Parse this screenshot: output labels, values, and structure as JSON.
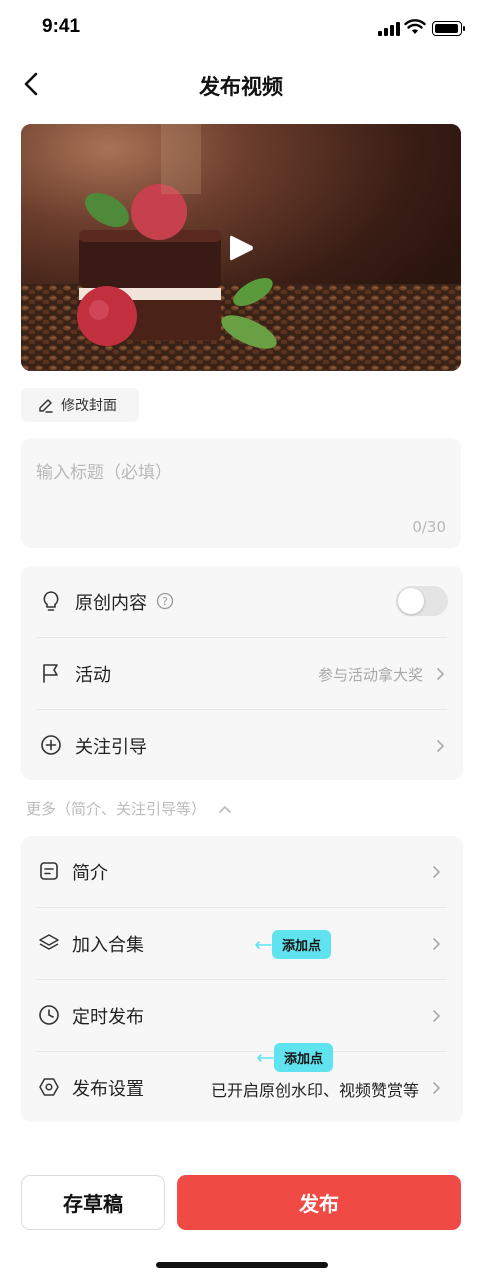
{
  "status_bar": {
    "time": "9:41"
  },
  "nav": {
    "title": "发布视频"
  },
  "video": {
    "cover_button_label": "修改封面"
  },
  "title_input": {
    "placeholder": "输入标题（必填）",
    "counter": "0/30"
  },
  "group_main": {
    "original": {
      "label": "原创内容",
      "toggle_on": false
    },
    "activity": {
      "label": "活动",
      "value": "参与活动拿大奖"
    },
    "follow_guide": {
      "label": "关注引导"
    }
  },
  "more": {
    "label": "更多（简介、关注引导等）"
  },
  "group_more": {
    "intro": {
      "label": "简介"
    },
    "collection": {
      "label": "加入合集"
    },
    "schedule": {
      "label": "定时发布"
    },
    "publish_settings": {
      "label": "发布设置",
      "value": "已开启原创水印、视频赞赏等"
    }
  },
  "annotations": [
    {
      "text": "添加点"
    },
    {
      "text": "添加点"
    }
  ],
  "actions": {
    "draft_label": "存草稿",
    "publish_label": "发布"
  },
  "colors": {
    "primary": "#ef4b44",
    "annotation": "#5fe4ef"
  }
}
